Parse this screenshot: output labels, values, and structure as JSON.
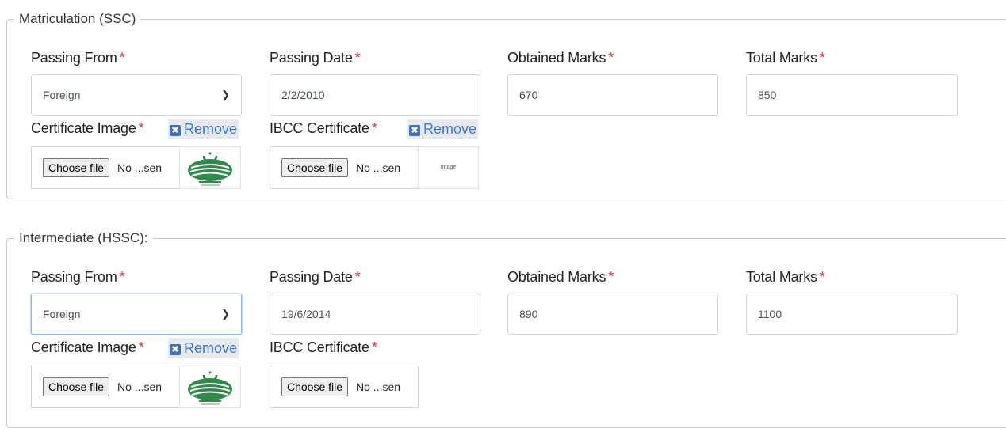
{
  "ssc": {
    "legend": "Matriculation (SSC)",
    "passing_from": {
      "label": "Passing From",
      "value": "Foreign"
    },
    "passing_date": {
      "label": "Passing Date",
      "value": "2/2/2010"
    },
    "obtained_marks": {
      "label": "Obtained Marks",
      "value": "670"
    },
    "total_marks": {
      "label": "Total Marks",
      "value": "850"
    },
    "certificate_image": {
      "label": "Certificate Image",
      "remove": "Remove",
      "choose": "Choose file",
      "file": "No ...sen"
    },
    "ibcc_certificate": {
      "label": "IBCC Certificate",
      "remove": "Remove",
      "choose": "Choose file",
      "file": "No ...sen",
      "preview_text": "Image"
    }
  },
  "hssc": {
    "legend": "Intermediate (HSSC):",
    "passing_from": {
      "label": "Passing From",
      "value": "Foreign"
    },
    "passing_date": {
      "label": "Passing Date",
      "value": "19/6/2014"
    },
    "obtained_marks": {
      "label": "Obtained Marks",
      "value": "890"
    },
    "total_marks": {
      "label": "Total Marks",
      "value": "1100"
    },
    "certificate_image": {
      "label": "Certificate Image",
      "remove": "Remove",
      "choose": "Choose file",
      "file": "No ...sen"
    },
    "ibcc_certificate": {
      "label": "IBCC Certificate",
      "choose": "Choose file",
      "file": "No ...sen"
    }
  },
  "required_mark": "*",
  "colors": {
    "required": "#dc3545",
    "remove_link": "#3a7bd5",
    "focus_border": "#80bdff"
  }
}
